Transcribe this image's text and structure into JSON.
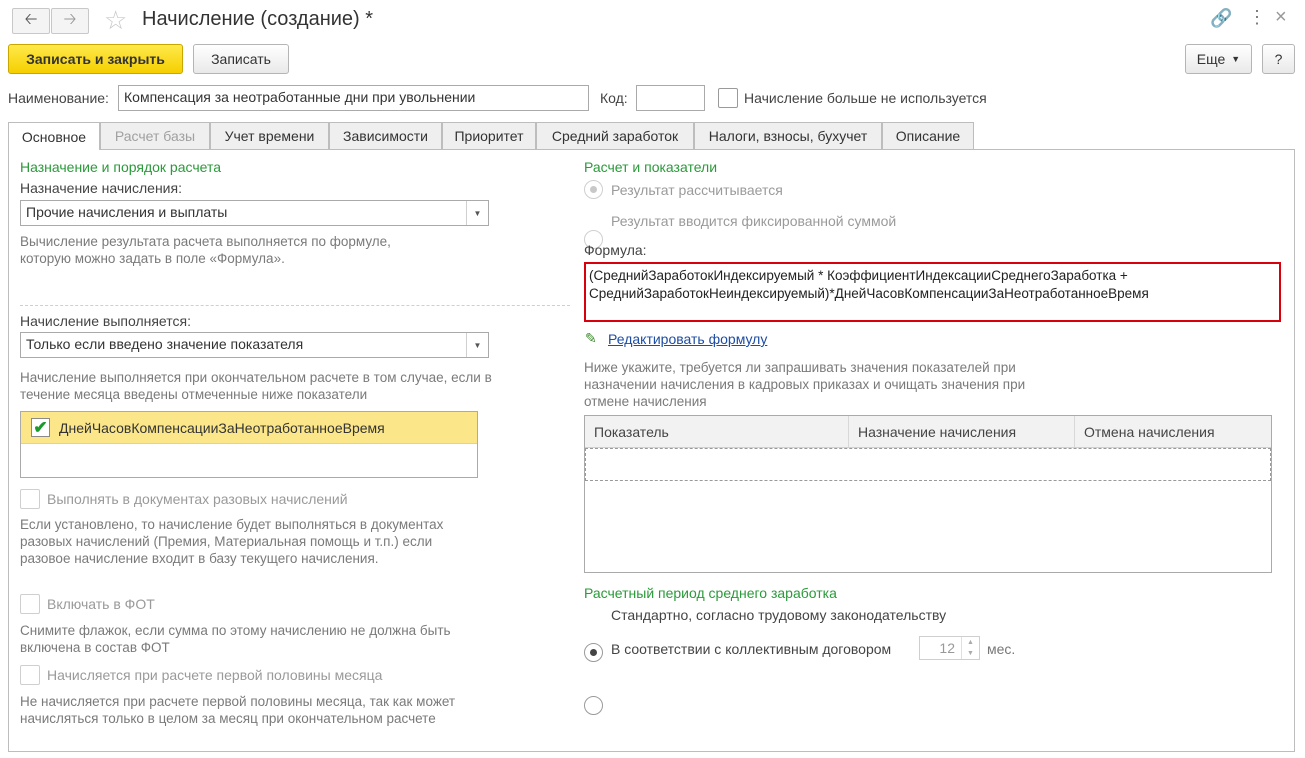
{
  "window": {
    "title": "Начисление (создание) *"
  },
  "toolbar": {
    "save_close": "Записать и закрыть",
    "save": "Записать",
    "more": "Еще",
    "help": "?"
  },
  "form": {
    "name_label": "Наименование:",
    "name_value": "Компенсация за неотработанные дни при увольнении",
    "code_label": "Код:",
    "code_value": "",
    "unused_label": "Начисление больше не используется"
  },
  "tabs": [
    "Основное",
    "Расчет базы",
    "Учет времени",
    "Зависимости",
    "Приоритет",
    "Средний заработок",
    "Налоги, взносы, бухучет",
    "Описание"
  ],
  "left": {
    "section_title": "Назначение и порядок расчета",
    "purpose_label": "Назначение начисления:",
    "purpose_value": "Прочие начисления и выплаты",
    "purpose_hint": "Вычисление результата расчета выполняется по формуле, которую можно задать в поле «Формула».",
    "exec_label": "Начисление выполняется:",
    "exec_value": "Только если введено значение показателя",
    "exec_hint": "Начисление выполняется при окончательном расчете в том случае, если в течение месяца введены отмеченные ниже показатели",
    "indicator_item": "ДнейЧасовКомпенсацииЗаНеотработанноеВремя",
    "one_time_label": "Выполнять в документах разовых начислений",
    "one_time_hint": "Если установлено, то начисление будет выполняться в документах разовых начислений (Премия, Материальная помощь и т.п.) если разовое начисление входит в базу текущего начисления.",
    "fot_label": "Включать в ФОТ",
    "fot_hint": "Снимите флажок, если сумма по этому начислению не должна быть включена в состав ФОТ",
    "half_label": "Начисляется при расчете первой половины месяца",
    "half_hint": "Не начисляется при расчете первой половины месяца, так как может начисляться только в целом за месяц при окончательном расчете"
  },
  "right": {
    "section_title": "Расчет и показатели",
    "radio_calc": "Результат рассчитывается",
    "radio_fixed": "Результат вводится фиксированной суммой",
    "formula_label": "Формула:",
    "formula_line1": "(СреднийЗаработокИндексируемый * КоэффициентИндексацииСреднегоЗаработка +",
    "formula_line2": "СреднийЗаработокНеиндексируемый)*ДнейЧасовКомпенсацииЗаНеотработанноеВремя",
    "edit_formula": "Редактировать формулу",
    "indicators_hint": "Ниже укажите, требуется ли запрашивать значения показателей при назначении начисления в кадровых приказах и очищать значения при отмене начисления",
    "table_headers": [
      "Показатель",
      "Назначение начисления",
      "Отмена начисления"
    ],
    "period_title": "Расчетный период среднего заработка",
    "period_standard": "Стандартно, согласно трудовому законодательству",
    "period_collective": "В соответствии с коллективным договором",
    "months_value": "12",
    "months_unit": "мес."
  },
  "colors": {
    "accent": "#2a9a3a",
    "primary_button": "#f5cf00",
    "highlight_border": "#d9000d",
    "selected_row": "#fbe78a",
    "link": "#1c4ca3"
  }
}
